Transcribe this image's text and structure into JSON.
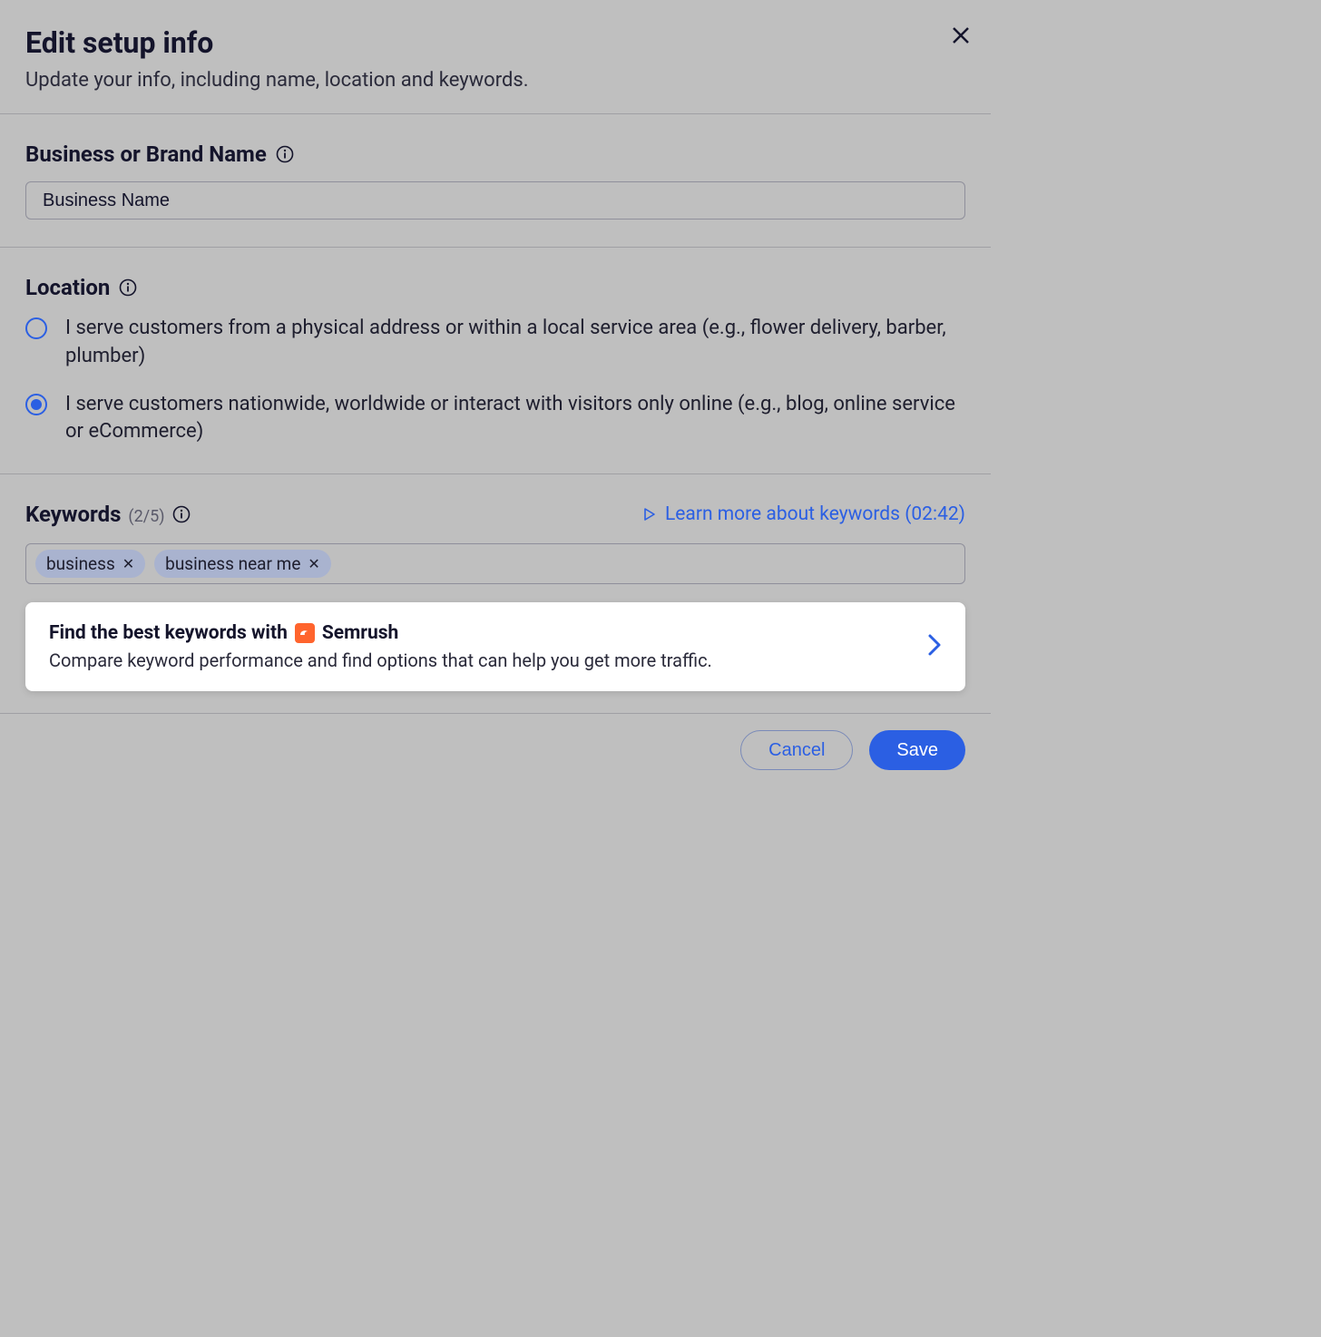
{
  "header": {
    "title": "Edit setup info",
    "subtitle": "Update your info, including name, location and keywords."
  },
  "business": {
    "label": "Business or Brand Name",
    "value": "Business Name"
  },
  "location": {
    "label": "Location",
    "options": [
      {
        "text": "I serve customers from a physical address or within a local service area (e.g., flower delivery, barber, plumber)",
        "selected": false
      },
      {
        "text": "I serve customers nationwide, worldwide or interact with visitors only online (e.g., blog, online service or eCommerce)",
        "selected": true
      }
    ]
  },
  "keywords": {
    "label": "Keywords",
    "count_text": "(2/5)",
    "learn_more": "Learn more about keywords (02:42)",
    "chips": [
      "business",
      "business near me"
    ]
  },
  "promo": {
    "title_prefix": "Find the best keywords with",
    "brand": "Semrush",
    "subtitle": "Compare keyword performance and find options that can help you get more traffic."
  },
  "footer": {
    "cancel": "Cancel",
    "save": "Save"
  }
}
